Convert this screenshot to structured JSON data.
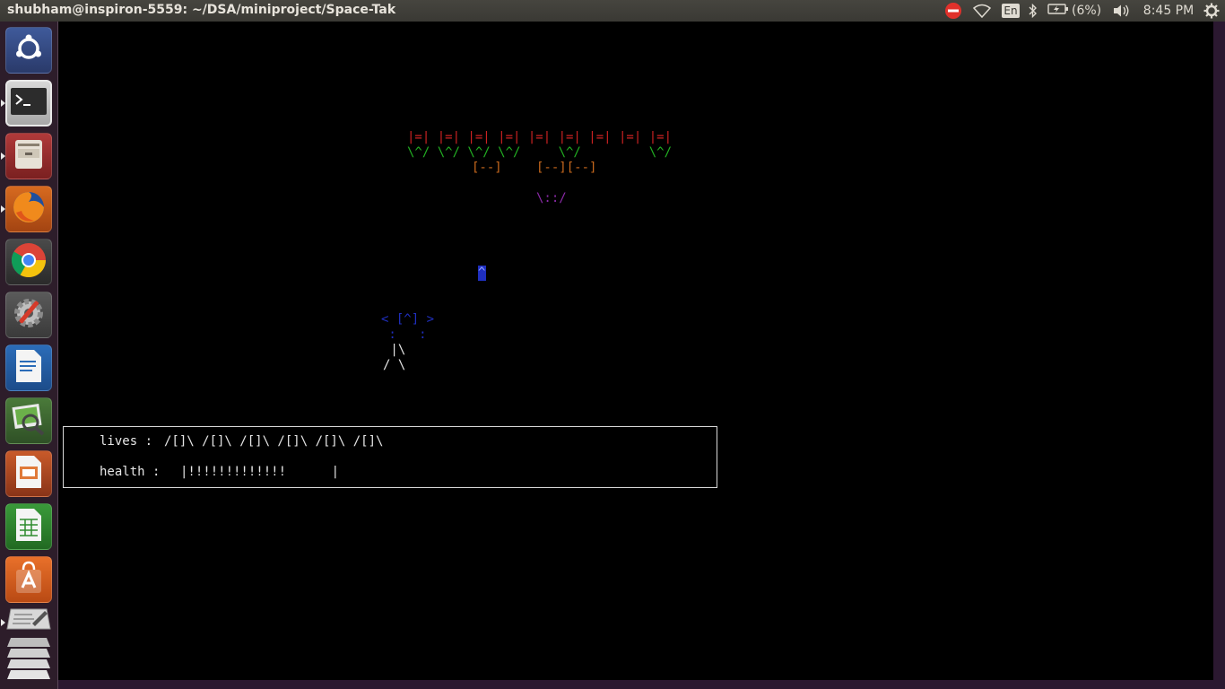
{
  "window": {
    "title": "shubham@inspiron-5559: ~/DSA/miniproject/Space-Tak"
  },
  "panel": {
    "keyboard_layout": "En",
    "battery_text": "(6%)",
    "time": "8:45 PM",
    "indicators": [
      "no-entry-icon",
      "wifi-icon",
      "keyboard-icon",
      "bluetooth-icon",
      "battery-icon",
      "volume-icon",
      "power-gear-icon"
    ]
  },
  "launcher": {
    "items": [
      "ubuntu-dash",
      "terminal",
      "files",
      "firefox",
      "chrome",
      "system-settings",
      "libreoffice-writer",
      "image-viewer",
      "libreoffice-impress",
      "libreoffice-calc",
      "software-center",
      "text-editor",
      "workspace-switcher"
    ]
  },
  "game": {
    "enemy_row_1": "|=| |=| |=| |=| |=| |=| |=| |=| |=|",
    "enemy_row_2": "\\^/ \\^/ \\^/ \\^/     \\^/         \\^/",
    "enemy_row_3a": "[--]",
    "enemy_row_3b": "[--][--]",
    "enemy_bullet": "\\::/",
    "player_bullet": "^",
    "player_head": "< [^] >",
    "player_feet": " :   :",
    "player_body": " |\\",
    "player_legs": "/ \\"
  },
  "status": {
    "lives_label": "lives :",
    "lives_value": "/[]\\ /[]\\ /[]\\ /[]\\ /[]\\ /[]\\",
    "health_label": "health :",
    "health_value": "|!!!!!!!!!!!!!      |"
  },
  "colors": {
    "enemy_red": "#cc2222",
    "enemy_green": "#22b022",
    "enemy_orange": "#c8691d",
    "enemy_bullet_purple": "#8b2aa8",
    "player_blue": "#1f2fbf",
    "launcher_bg": "#2d1d2a",
    "panel_bg": "#3c3b37"
  }
}
